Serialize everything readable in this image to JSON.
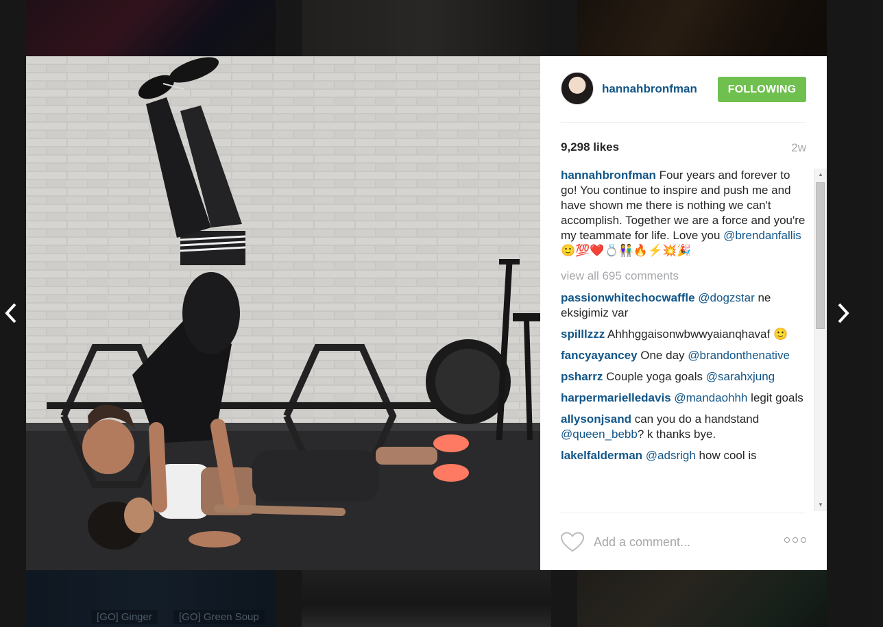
{
  "background": {
    "captions": [
      "[GO] Ginger",
      "[GO] Green Soup"
    ]
  },
  "post": {
    "username": "hannahbronfman",
    "follow_label": "FOLLOWING",
    "likes_count": "9,298",
    "likes_word": "likes",
    "timestamp": "2w",
    "caption": {
      "user": "hannahbronfman",
      "text": " Four years and forever to go! You continue to inspire and push me and have shown me there is nothing we can't accomplish. Together we are a force and you're my teammate for life. Love you ",
      "mention": "@brendanfallis",
      "emojis": " 🙂💯❤️💍👫🔥⚡💥🎉"
    },
    "view_all_comments": "view all 695 comments",
    "comments": [
      {
        "user": "passionwhitechocwaffle",
        "mention": "@dogzstar",
        "text": " ne eksigimiz var"
      },
      {
        "user": "spilllzzz",
        "text": " Ahhhggaisonwbwwyaianqhavaf 🙂"
      },
      {
        "user": "fancyayancey",
        "text": " One day ",
        "mention": "@brandonthenative"
      },
      {
        "user": "psharrz",
        "text": " Couple yoga goals ",
        "mention": "@sarahxjung"
      },
      {
        "user": "harpermarielledavis",
        "mention": "@mandaohhh",
        "text": " legit goals"
      },
      {
        "user": "allysonjsand",
        "text": " can you do a handstand ",
        "mention": "@queen_bebb",
        "text_after": "? k thanks bye."
      },
      {
        "user": "lakelfalderman",
        "mention": "@adsrigh",
        "text": " how cool is"
      }
    ],
    "comment_placeholder": "Add a comment...",
    "accent_color": "#70c050",
    "link_color": "#125688"
  }
}
